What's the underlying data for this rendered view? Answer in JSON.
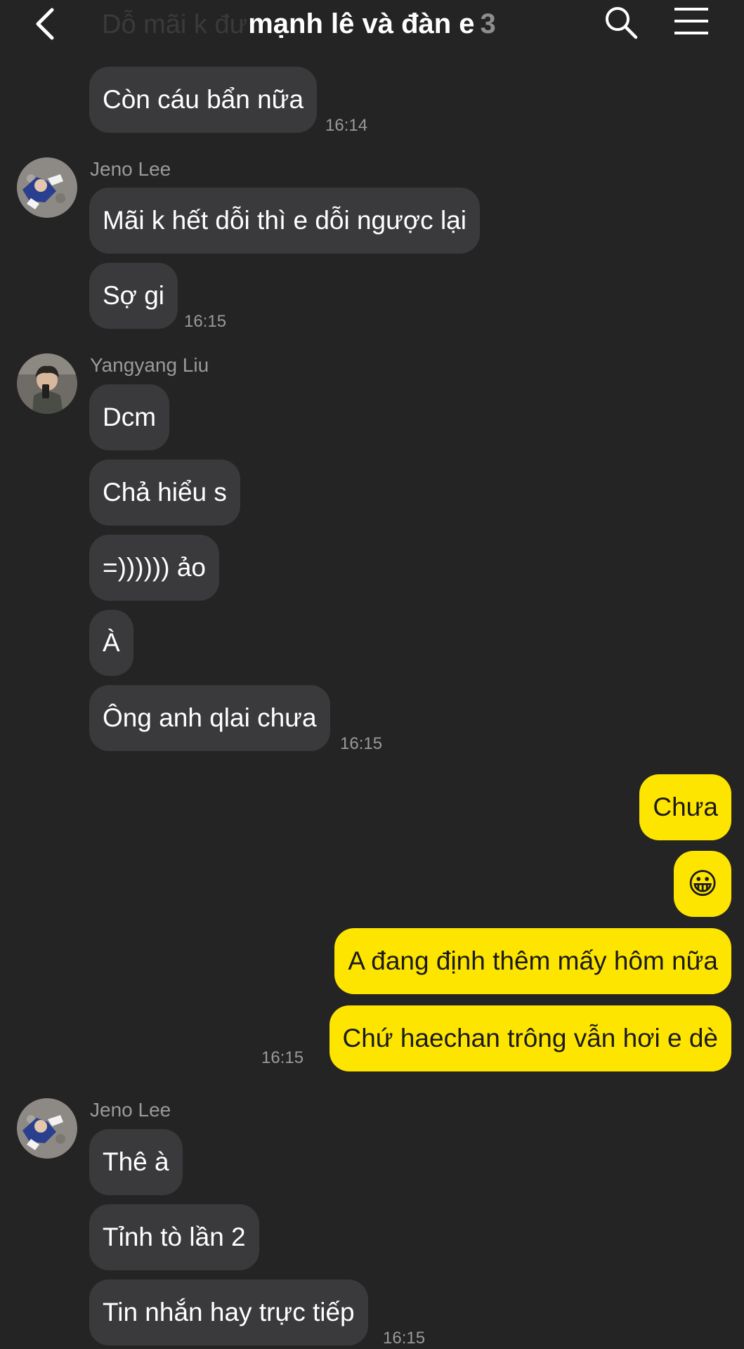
{
  "header": {
    "title": "mạnh lê và đàn e",
    "member_count": "3",
    "faded_preview": "Dỗ mãi k đư"
  },
  "messages": {
    "m1": "Còn cáu bẩn nữa",
    "t1": "16:14",
    "jeno_name": "Jeno Lee",
    "m2": "Mãi k hết dỗi thì e dỗi ngược lại",
    "m3": "Sợ gi",
    "t2": "16:15",
    "yang_name": "Yangyang Liu",
    "m4": "Dcm",
    "m5": "Chả hiểu s",
    "m6": "=)))))) ảo",
    "m7": "À",
    "m8": "Ông anh qlai chưa",
    "t3": "16:15",
    "o1": "Chưa",
    "o2": "😀",
    "o3": "A đang định thêm mấy hôm nữa",
    "o4": "Chứ haechan trông vẫn hơi e dè",
    "t4": "16:15",
    "jeno_name2": "Jeno Lee",
    "m9": "Thê à",
    "m10": "Tỉnh tò lần 2",
    "m11": "Tin nhắn hay trực tiếp",
    "t5": "16:15"
  },
  "colors": {
    "background": "#242424",
    "incoming_bubble": "#3a3a3c",
    "outgoing_bubble": "#fee500",
    "meta_text": "#9a9a9a"
  },
  "icons": {
    "back": "chevron-left-icon",
    "search": "search-icon",
    "menu": "menu-icon"
  }
}
